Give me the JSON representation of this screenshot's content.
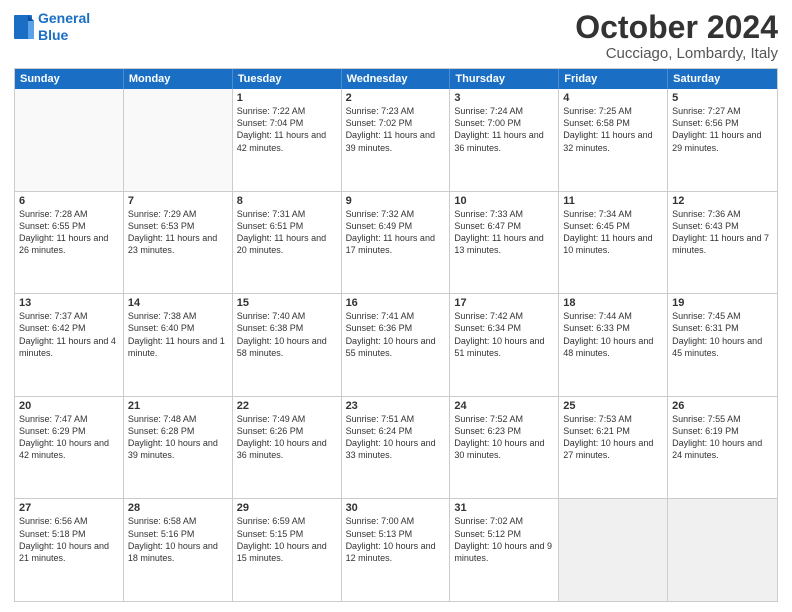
{
  "logo": {
    "line1": "General",
    "line2": "Blue"
  },
  "title": "October 2024",
  "location": "Cucciago, Lombardy, Italy",
  "weekdays": [
    "Sunday",
    "Monday",
    "Tuesday",
    "Wednesday",
    "Thursday",
    "Friday",
    "Saturday"
  ],
  "rows": [
    [
      {
        "day": "",
        "text": "",
        "empty": true
      },
      {
        "day": "",
        "text": "",
        "empty": true
      },
      {
        "day": "1",
        "text": "Sunrise: 7:22 AM\nSunset: 7:04 PM\nDaylight: 11 hours and 42 minutes."
      },
      {
        "day": "2",
        "text": "Sunrise: 7:23 AM\nSunset: 7:02 PM\nDaylight: 11 hours and 39 minutes."
      },
      {
        "day": "3",
        "text": "Sunrise: 7:24 AM\nSunset: 7:00 PM\nDaylight: 11 hours and 36 minutes."
      },
      {
        "day": "4",
        "text": "Sunrise: 7:25 AM\nSunset: 6:58 PM\nDaylight: 11 hours and 32 minutes."
      },
      {
        "day": "5",
        "text": "Sunrise: 7:27 AM\nSunset: 6:56 PM\nDaylight: 11 hours and 29 minutes."
      }
    ],
    [
      {
        "day": "6",
        "text": "Sunrise: 7:28 AM\nSunset: 6:55 PM\nDaylight: 11 hours and 26 minutes."
      },
      {
        "day": "7",
        "text": "Sunrise: 7:29 AM\nSunset: 6:53 PM\nDaylight: 11 hours and 23 minutes."
      },
      {
        "day": "8",
        "text": "Sunrise: 7:31 AM\nSunset: 6:51 PM\nDaylight: 11 hours and 20 minutes."
      },
      {
        "day": "9",
        "text": "Sunrise: 7:32 AM\nSunset: 6:49 PM\nDaylight: 11 hours and 17 minutes."
      },
      {
        "day": "10",
        "text": "Sunrise: 7:33 AM\nSunset: 6:47 PM\nDaylight: 11 hours and 13 minutes."
      },
      {
        "day": "11",
        "text": "Sunrise: 7:34 AM\nSunset: 6:45 PM\nDaylight: 11 hours and 10 minutes."
      },
      {
        "day": "12",
        "text": "Sunrise: 7:36 AM\nSunset: 6:43 PM\nDaylight: 11 hours and 7 minutes."
      }
    ],
    [
      {
        "day": "13",
        "text": "Sunrise: 7:37 AM\nSunset: 6:42 PM\nDaylight: 11 hours and 4 minutes."
      },
      {
        "day": "14",
        "text": "Sunrise: 7:38 AM\nSunset: 6:40 PM\nDaylight: 11 hours and 1 minute."
      },
      {
        "day": "15",
        "text": "Sunrise: 7:40 AM\nSunset: 6:38 PM\nDaylight: 10 hours and 58 minutes."
      },
      {
        "day": "16",
        "text": "Sunrise: 7:41 AM\nSunset: 6:36 PM\nDaylight: 10 hours and 55 minutes."
      },
      {
        "day": "17",
        "text": "Sunrise: 7:42 AM\nSunset: 6:34 PM\nDaylight: 10 hours and 51 minutes."
      },
      {
        "day": "18",
        "text": "Sunrise: 7:44 AM\nSunset: 6:33 PM\nDaylight: 10 hours and 48 minutes."
      },
      {
        "day": "19",
        "text": "Sunrise: 7:45 AM\nSunset: 6:31 PM\nDaylight: 10 hours and 45 minutes."
      }
    ],
    [
      {
        "day": "20",
        "text": "Sunrise: 7:47 AM\nSunset: 6:29 PM\nDaylight: 10 hours and 42 minutes."
      },
      {
        "day": "21",
        "text": "Sunrise: 7:48 AM\nSunset: 6:28 PM\nDaylight: 10 hours and 39 minutes."
      },
      {
        "day": "22",
        "text": "Sunrise: 7:49 AM\nSunset: 6:26 PM\nDaylight: 10 hours and 36 minutes."
      },
      {
        "day": "23",
        "text": "Sunrise: 7:51 AM\nSunset: 6:24 PM\nDaylight: 10 hours and 33 minutes."
      },
      {
        "day": "24",
        "text": "Sunrise: 7:52 AM\nSunset: 6:23 PM\nDaylight: 10 hours and 30 minutes."
      },
      {
        "day": "25",
        "text": "Sunrise: 7:53 AM\nSunset: 6:21 PM\nDaylight: 10 hours and 27 minutes."
      },
      {
        "day": "26",
        "text": "Sunrise: 7:55 AM\nSunset: 6:19 PM\nDaylight: 10 hours and 24 minutes."
      }
    ],
    [
      {
        "day": "27",
        "text": "Sunrise: 6:56 AM\nSunset: 5:18 PM\nDaylight: 10 hours and 21 minutes."
      },
      {
        "day": "28",
        "text": "Sunrise: 6:58 AM\nSunset: 5:16 PM\nDaylight: 10 hours and 18 minutes."
      },
      {
        "day": "29",
        "text": "Sunrise: 6:59 AM\nSunset: 5:15 PM\nDaylight: 10 hours and 15 minutes."
      },
      {
        "day": "30",
        "text": "Sunrise: 7:00 AM\nSunset: 5:13 PM\nDaylight: 10 hours and 12 minutes."
      },
      {
        "day": "31",
        "text": "Sunrise: 7:02 AM\nSunset: 5:12 PM\nDaylight: 10 hours and 9 minutes."
      },
      {
        "day": "",
        "text": "",
        "empty": true,
        "shaded": true
      },
      {
        "day": "",
        "text": "",
        "empty": true,
        "shaded": true
      }
    ]
  ]
}
